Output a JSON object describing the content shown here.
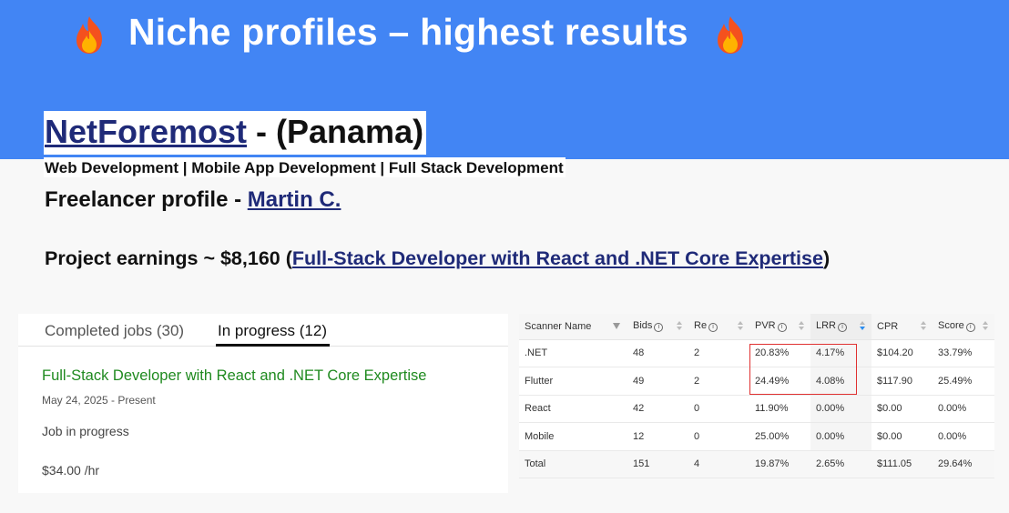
{
  "slide": {
    "title": "Niche profiles – highest results",
    "icons": [
      "fire-icon",
      "fire-icon"
    ]
  },
  "profile": {
    "company_name": "NetForemost",
    "company_suffix": " - (Panama)",
    "services": "Web Development | Mobile App Development | Full Stack Development",
    "freelancer_prefix": "Freelancer profile - ",
    "freelancer_name": "Martin C.",
    "earnings_prefix": "Project earnings ~ $8,160 (",
    "earnings_link": "Full-Stack Developer with React and .NET Core Expertise",
    "earnings_suffix": ")"
  },
  "jobs_card": {
    "tabs": [
      {
        "label": "Completed jobs (30)",
        "active": false
      },
      {
        "label": "In progress (12)",
        "active": true
      }
    ],
    "job": {
      "title": "Full-Stack Developer with React and .NET Core Expertise",
      "dates": "May 24, 2025 - Present",
      "status": "Job in progress",
      "rate": "$34.00 /hr"
    }
  },
  "scanner_table": {
    "columns": [
      "Scanner Name",
      "Bids",
      "Re",
      "PVR",
      "LRR",
      "CPR",
      "Score"
    ],
    "rows": [
      [
        ".NET",
        "48",
        "2",
        "20.83%",
        "4.17%",
        "$104.20",
        "33.79%"
      ],
      [
        "Flutter",
        "49",
        "2",
        "24.49%",
        "4.08%",
        "$117.90",
        "25.49%"
      ],
      [
        "React",
        "42",
        "0",
        "11.90%",
        "0.00%",
        "$0.00",
        "0.00%"
      ],
      [
        "Mobile",
        "12",
        "0",
        "25.00%",
        "0.00%",
        "$0.00",
        "0.00%"
      ],
      [
        "Total",
        "151",
        "4",
        "19.87%",
        "2.65%",
        "$111.05",
        "29.64%"
      ]
    ]
  },
  "colors": {
    "banner": "#4285f4",
    "link": "#1f2a78",
    "job_title": "#1f8a1f",
    "highlight": "#e03131",
    "sort_active": "#2a8df0"
  }
}
